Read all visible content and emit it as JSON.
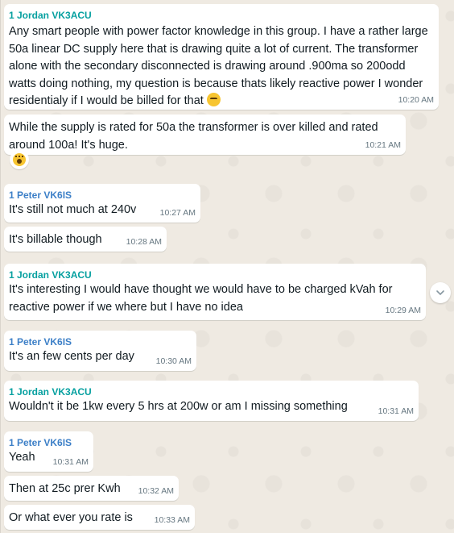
{
  "colors": {
    "chat_background": "#efeae2",
    "bubble": "#ffffff",
    "sender_jordan": "#06a0a0",
    "sender_peter": "#3c7fc7",
    "timestamp": "#667781"
  },
  "messages": [
    {
      "sender": "1 Jordan VK3ACU",
      "text": "Any smart people with power factor knowledge in this group. I have a rather large 50a linear DC supply here that is drawing quite a lot of current. The transformer alone with the secondary disconnected is drawing around .900ma so 200odd watts doing nothing, my question is because thats likely reactive power I wonder residentialy if I would be billed for that",
      "emoji": "thinking-face-icon",
      "time": "10:20 AM"
    },
    {
      "sender": "",
      "text": "While the supply is rated for 50a the transformer is over killed and rated around 100a! It's huge.",
      "time": "10:21 AM",
      "reaction": "astonished-face-icon"
    },
    {
      "sender": "1 Peter VK6IS",
      "text": "It's still not much at 240v",
      "time": "10:27 AM"
    },
    {
      "sender": "",
      "text": "It's billable though",
      "time": "10:28 AM"
    },
    {
      "sender": "1 Jordan VK3ACU",
      "text": "It's interesting I would have thought we would have to be charged kVah for reactive power if we where but I have no idea",
      "time": "10:29 AM"
    },
    {
      "sender": "1 Peter VK6IS",
      "text": "It's an few cents per day",
      "time": "10:30 AM"
    },
    {
      "sender": "1 Jordan VK3ACU",
      "text": "Wouldn't it be 1kw every 5 hrs at 200w or am I missing something",
      "time": "10:31 AM"
    },
    {
      "sender": "1 Peter VK6IS",
      "text": "Yeah",
      "time": "10:31 AM"
    },
    {
      "sender": "",
      "text": "Then at 25c prer Kwh",
      "time": "10:32 AM"
    },
    {
      "sender": "",
      "text": "Or what ever you rate is",
      "time": "10:33 AM"
    }
  ]
}
